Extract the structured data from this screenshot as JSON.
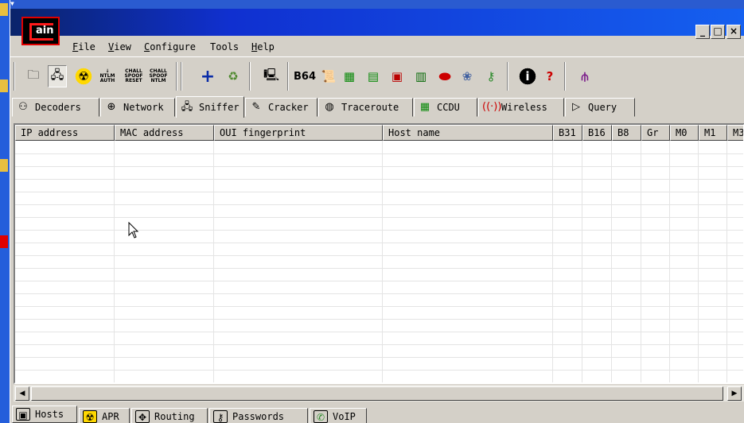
{
  "app": {
    "logo_text": "ain"
  },
  "window_controls": {
    "minimize": "_",
    "maximize": "□",
    "close": "×"
  },
  "menu": [
    {
      "key": "F",
      "rest": "ile"
    },
    {
      "key": "V",
      "rest": "iew"
    },
    {
      "key": "C",
      "rest": "onfigure"
    },
    {
      "key": "",
      "rest": "Tools"
    },
    {
      "key": "H",
      "rest": "elp"
    }
  ],
  "toolbar": {
    "ntlm_auth": [
      "NTLM",
      "AUTH"
    ],
    "chall_spoof_reset": [
      "CHALL",
      "SPOOF",
      "RESET"
    ],
    "chall_spoof_ntlm": [
      "CHALL",
      "SPOOF",
      "NTLM"
    ],
    "base64": "B64"
  },
  "tabs": [
    {
      "label": "Decoders"
    },
    {
      "label": "Network"
    },
    {
      "label": "Sniffer"
    },
    {
      "label": "Cracker"
    },
    {
      "label": "Traceroute"
    },
    {
      "label": "CCDU"
    },
    {
      "label": "Wireless"
    },
    {
      "label": "Query"
    }
  ],
  "columns": [
    {
      "label": "IP address"
    },
    {
      "label": "MAC address"
    },
    {
      "label": "OUI fingerprint"
    },
    {
      "label": "Host name"
    },
    {
      "label": "B31"
    },
    {
      "label": "B16"
    },
    {
      "label": "B8"
    },
    {
      "label": "Gr"
    },
    {
      "label": "M0"
    },
    {
      "label": "M1"
    },
    {
      "label": "M3"
    }
  ],
  "bottom_tabs": [
    {
      "label": "Hosts"
    },
    {
      "label": "APR"
    },
    {
      "label": "Routing"
    },
    {
      "label": "Passwords"
    },
    {
      "label": "VoIP"
    }
  ]
}
